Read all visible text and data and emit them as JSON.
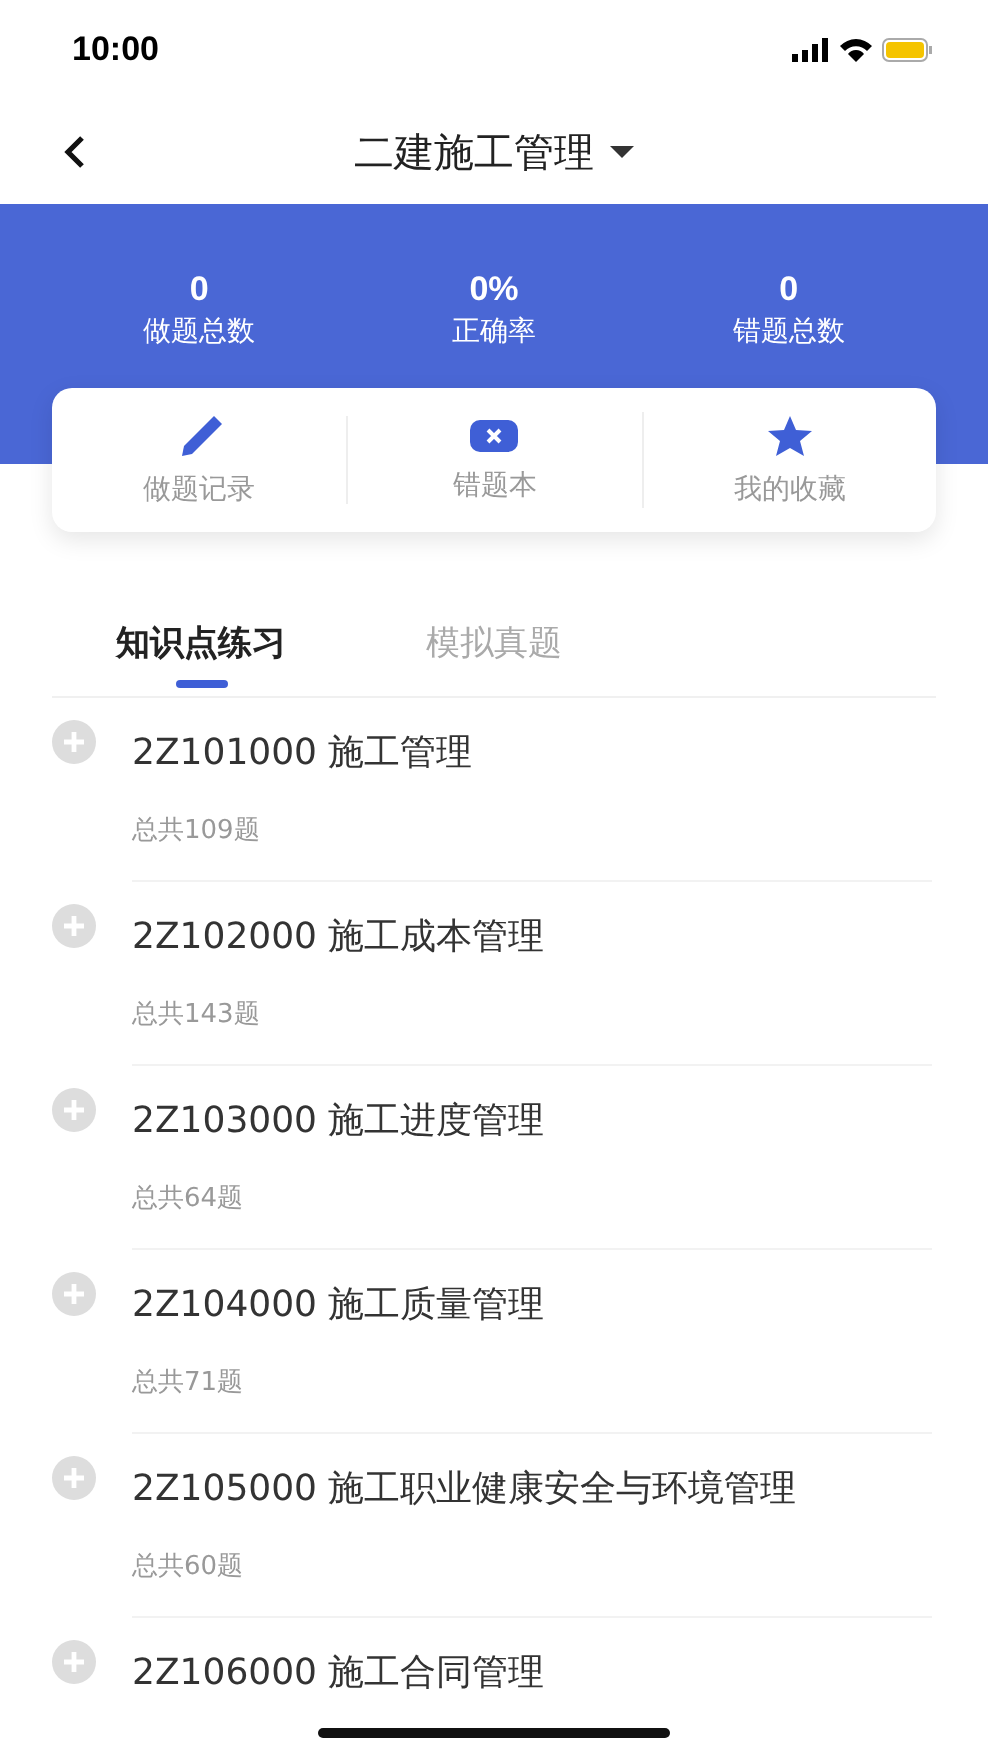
{
  "status_bar": {
    "time": "10:00"
  },
  "nav": {
    "title": "二建施工管理"
  },
  "stats": [
    {
      "value": "0",
      "label": "做题总数"
    },
    {
      "value": "0%",
      "label": "正确率"
    },
    {
      "value": "0",
      "label": "错题总数"
    }
  ],
  "shortcuts": [
    {
      "kind": "pencil",
      "label": "做题记录"
    },
    {
      "kind": "wrongbook",
      "label": "错题本"
    },
    {
      "kind": "star",
      "label": "我的收藏"
    }
  ],
  "tabs": [
    {
      "label": "知识点练习",
      "selected": true
    },
    {
      "label": "模拟真题",
      "selected": false
    }
  ],
  "topics": [
    {
      "title": "2Z101000 施工管理",
      "count": "总共109题"
    },
    {
      "title": "2Z102000 施工成本管理",
      "count": "总共143题"
    },
    {
      "title": "2Z103000 施工进度管理",
      "count": "总共64题"
    },
    {
      "title": "2Z104000 施工质量管理",
      "count": "总共71题"
    },
    {
      "title": "2Z105000 施工职业健康安全与环境管理",
      "count": "总共60题"
    },
    {
      "title": "2Z106000 施工合同管理"
    }
  ]
}
